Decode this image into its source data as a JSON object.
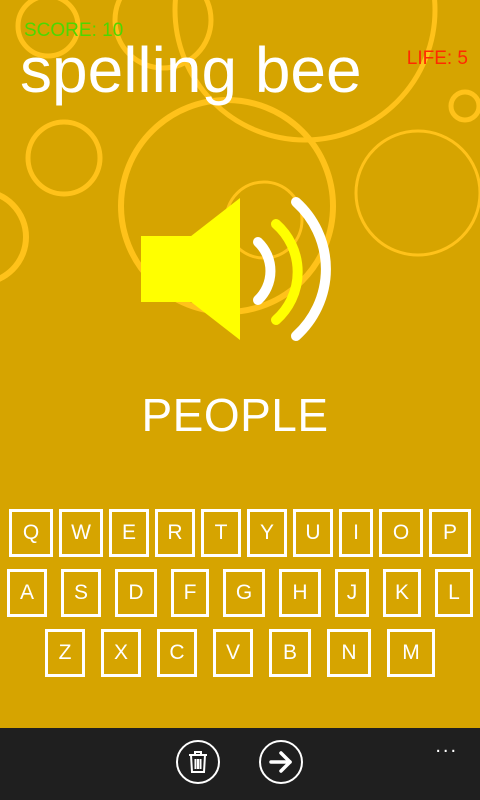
{
  "header": {
    "score_text": "SCORE: 10",
    "life_text": "LIFE: 5",
    "title": "spelling bee"
  },
  "game": {
    "word": "PEOPLE",
    "speaker_icon": "speaker-volume-icon"
  },
  "keyboard": {
    "rows": [
      [
        "Q",
        "W",
        "E",
        "R",
        "T",
        "Y",
        "U",
        "I",
        "O",
        "P"
      ],
      [
        "A",
        "S",
        "D",
        "F",
        "G",
        "H",
        "J",
        "K",
        "L"
      ],
      [
        "Z",
        "X",
        "C",
        "V",
        "B",
        "N",
        "M"
      ]
    ]
  },
  "appbar": {
    "delete_icon": "trash-icon",
    "next_icon": "arrow-right-icon",
    "more": "..."
  },
  "colors": {
    "background": "#d6a400",
    "circle_stroke": "#ffc21a",
    "speaker_fill": "#ffff00",
    "score": "#4cd800",
    "life": "#ff2a00",
    "appbar": "#1f1f1f"
  }
}
